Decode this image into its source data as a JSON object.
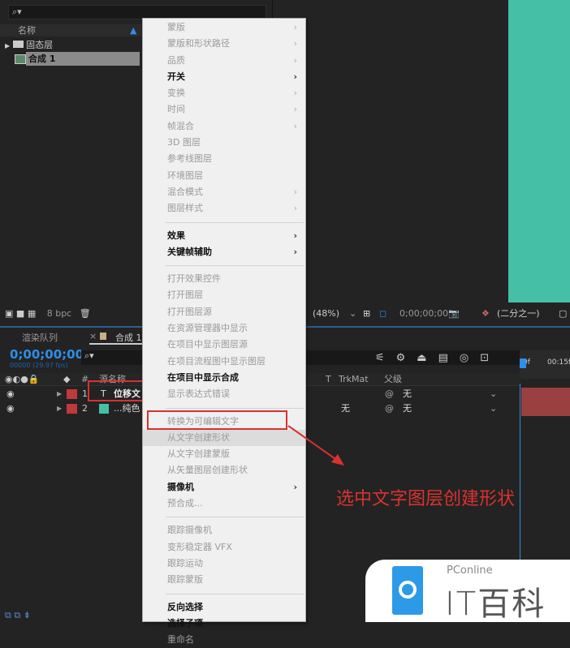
{
  "project": {
    "search_icon": "search-icon",
    "column_name": "名称",
    "items": [
      {
        "label": "固态层",
        "type": "folder"
      },
      {
        "label": "合成 1",
        "type": "composition"
      }
    ]
  },
  "toolbar": {
    "bpc": "8 bpc",
    "zoom": "(48%)",
    "timecode": "0;00;00;00",
    "resolution": "(二分之一)"
  },
  "tabs": {
    "render_queue": "渲染队列",
    "comp": "合成 1"
  },
  "timeline": {
    "timecode": "0;00;00;00",
    "fps": "00000 (29.97 fps)",
    "ruler": [
      "0f",
      "00:15f"
    ],
    "headers": {
      "num": "#",
      "source": "源名称",
      "t": "T",
      "trkmat": "TrkMat",
      "parent": "父级"
    },
    "layers": [
      {
        "num": "1",
        "type": "T",
        "name": "位移文",
        "trkmat": "",
        "parent": "无"
      },
      {
        "num": "2",
        "type": "solid",
        "name": "...纯色",
        "trkmat": "无",
        "parent": "无"
      }
    ]
  },
  "menu": {
    "groups": [
      [
        {
          "label": "蒙版",
          "sub": true
        },
        {
          "label": "蒙版和形状路径",
          "sub": true
        },
        {
          "label": "品质",
          "sub": true
        },
        {
          "label": "开关",
          "sub": true,
          "enabled": true
        },
        {
          "label": "变换",
          "sub": true
        },
        {
          "label": "时间",
          "sub": true
        },
        {
          "label": "帧混合",
          "sub": true
        },
        {
          "label": "3D 图层"
        },
        {
          "label": "参考线图层"
        },
        {
          "label": "环境图层"
        },
        {
          "label": "混合模式",
          "sub": true
        },
        {
          "label": "图层样式",
          "sub": true
        }
      ],
      [
        {
          "label": "效果",
          "sub": true,
          "enabled": true
        },
        {
          "label": "关键帧辅助",
          "sub": true,
          "enabled": true
        }
      ],
      [
        {
          "label": "打开效果控件"
        },
        {
          "label": "打开图层"
        },
        {
          "label": "打开图层源"
        },
        {
          "label": "在资源管理器中显示"
        },
        {
          "label": "在项目中显示图层源"
        },
        {
          "label": "在项目流程图中显示图层"
        },
        {
          "label": "在项目中显示合成",
          "enabled": true
        },
        {
          "label": "显示表达式错误"
        }
      ],
      [
        {
          "label": "转换为可编辑文字"
        },
        {
          "label": "从文字创建形状",
          "highlight": true
        },
        {
          "label": "从文字创建蒙版"
        },
        {
          "label": "从矢量图层创建形状"
        },
        {
          "label": "摄像机",
          "sub": true,
          "enabled": true
        },
        {
          "label": "预合成..."
        }
      ],
      [
        {
          "label": "跟踪摄像机"
        },
        {
          "label": "变形稳定器 VFX"
        },
        {
          "label": "跟踪运动"
        },
        {
          "label": "跟踪蒙版"
        }
      ],
      [
        {
          "label": "反向选择",
          "enabled": true
        },
        {
          "label": "选择子项",
          "enabled": true
        },
        {
          "label": "重命名"
        }
      ]
    ]
  },
  "annotation": "选中文字图层创建形状",
  "watermark": {
    "brand": "PConline",
    "name": "IT百科"
  },
  "colors": {
    "accent": "#2e8ee8",
    "annotation": "#d8322f",
    "preview": "#45bfa5"
  }
}
